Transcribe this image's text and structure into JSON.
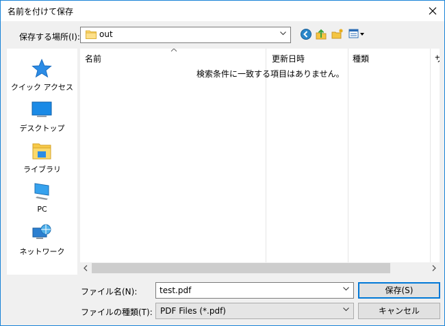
{
  "window": {
    "title": "名前を付けて保存"
  },
  "location": {
    "label": "保存する場所(I):",
    "folder": "out"
  },
  "places": [
    {
      "label": "クイック アクセス",
      "icon": "star-icon"
    },
    {
      "label": "デスクトップ",
      "icon": "desktop-icon"
    },
    {
      "label": "ライブラリ",
      "icon": "library-icon"
    },
    {
      "label": "PC",
      "icon": "computer-icon"
    },
    {
      "label": "ネットワーク",
      "icon": "network-icon"
    }
  ],
  "file_list": {
    "columns": [
      "名前",
      "更新日時",
      "種類",
      "サ"
    ],
    "empty_message": "検索条件に一致する項目はありません。"
  },
  "form": {
    "filename_label": "ファイル名(N):",
    "filename_value": "test.pdf",
    "filetype_label": "ファイルの種類(T):",
    "filetype_value": "PDF Files (*.pdf)"
  },
  "buttons": {
    "save": "保存(S)",
    "cancel": "キャンセル"
  },
  "colors": {
    "accent": "#0078d7",
    "border": "#1883d7"
  }
}
